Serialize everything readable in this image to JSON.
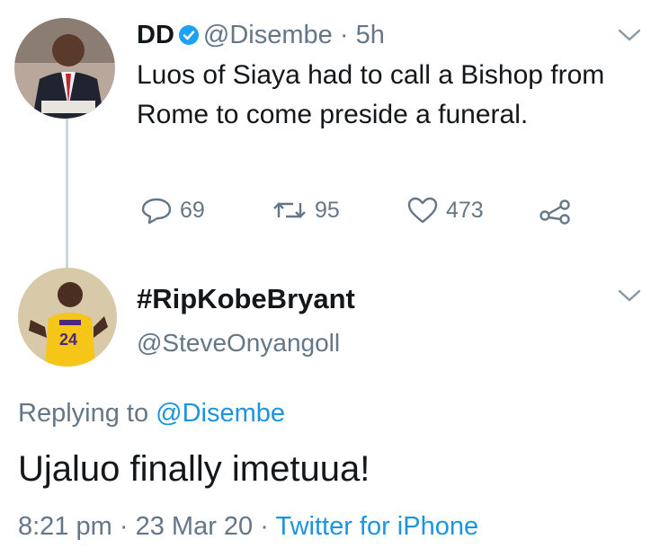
{
  "tweet1": {
    "display_name": "DD",
    "handle": "@Disembe",
    "separator": "·",
    "time": "5h",
    "text": "Luos of Siaya had to call a Bishop from Rome to come preside a funeral.",
    "replies": "69",
    "retweets": "95",
    "likes": "473"
  },
  "tweet2": {
    "display_name": "#RipKobeBryant",
    "handle": "@SteveOnyangoll",
    "replying_prefix": "Replying to",
    "replying_handle": "@Disembe",
    "text": "Ujaluo finally imetuua!",
    "time": "8:21 pm",
    "sep1": "·",
    "date": "23 Mar 20",
    "sep2": "·",
    "source": "Twitter for iPhone"
  },
  "icons": [
    "reply-icon",
    "retweet-icon",
    "like-icon",
    "share-icon",
    "verified-icon",
    "chevron-down-icon"
  ],
  "colors": {
    "link": "#1b95e0",
    "muted": "#657786",
    "text": "#14171a",
    "verified": "#1da1f2"
  }
}
